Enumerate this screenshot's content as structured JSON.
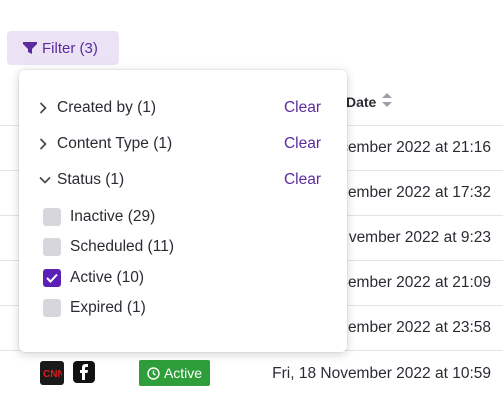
{
  "filter_button": {
    "label": "Filter (3)"
  },
  "table": {
    "date_header": "Date",
    "rows": [
      {
        "date": "cember 2022 at 21:16"
      },
      {
        "date": "ember 2022 at 17:32"
      },
      {
        "date": "vember 2022 at 9:23"
      },
      {
        "date": "ember 2022 at 21:09"
      },
      {
        "date": "ember 2022 at 23:58"
      },
      {
        "date": "Fri, 18 November 2022 at 10:59",
        "status": "Active"
      }
    ]
  },
  "filter_panel": {
    "sections": [
      {
        "label": "Created by (1)",
        "clear": "Clear",
        "expanded": false
      },
      {
        "label": "Content Type (1)",
        "clear": "Clear",
        "expanded": false
      },
      {
        "label": "Status (1)",
        "clear": "Clear",
        "expanded": true
      }
    ],
    "status_options": [
      {
        "label": "Inactive (29)",
        "checked": false
      },
      {
        "label": "Scheduled (11)",
        "checked": false
      },
      {
        "label": "Active (10)",
        "checked": true
      },
      {
        "label": "Expired (1)",
        "checked": false
      }
    ]
  },
  "colors": {
    "accent": "#5b21b6",
    "filter_bg": "#ebe3f5",
    "active_green": "#2e9e3a"
  }
}
